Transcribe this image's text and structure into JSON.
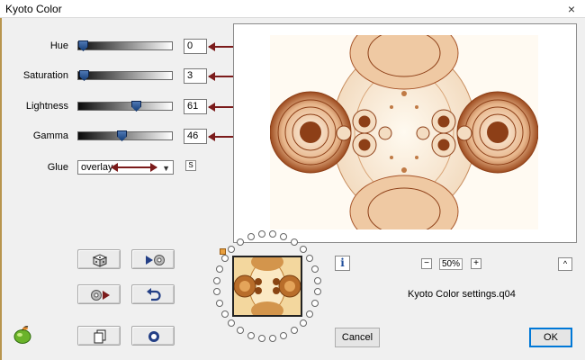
{
  "window": {
    "title": "Kyoto Color",
    "close_glyph": "×"
  },
  "params": [
    {
      "label": "Hue",
      "value": "0",
      "level": 0.02
    },
    {
      "label": "Saturation",
      "value": "3",
      "level": 0.03
    },
    {
      "label": "Lightness",
      "value": "61",
      "level": 0.61
    },
    {
      "label": "Gamma",
      "value": "46",
      "level": 0.46
    }
  ],
  "glue": {
    "label": "Glue",
    "value": "overlay",
    "side_button": "S"
  },
  "zoom": {
    "minus": "−",
    "value": "50%",
    "plus": "+"
  },
  "info_glyph": "i",
  "up_glyph": "^",
  "settings_file": "Kyoto Color settings.q04",
  "buttons": {
    "cancel": "Cancel",
    "ok": "OK"
  },
  "toolbar_icons": [
    "dice-icon",
    "play-reset-icon",
    "reset-play-icon",
    "undo-icon",
    "copy-icon",
    "circle-icon"
  ],
  "colors": {
    "accent": "#7b1b1b",
    "slider_thumb": "#2b5a9c",
    "ok_border": "#0078d7",
    "preview_tone": "#a8562a"
  }
}
